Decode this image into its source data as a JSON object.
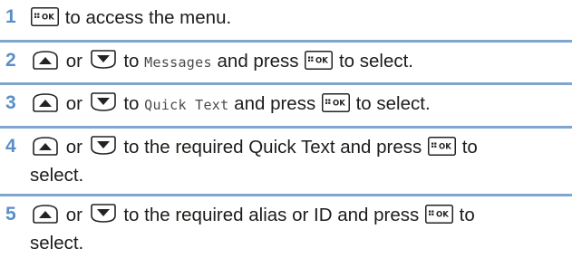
{
  "steps": [
    {
      "number": "1",
      "parts": [
        "to access the menu."
      ]
    },
    {
      "number": "2",
      "parts": [
        "or",
        "to",
        "Messages",
        "and press",
        "to select."
      ]
    },
    {
      "number": "3",
      "parts": [
        "or",
        "to",
        "Quick Text",
        "and press",
        "to select."
      ]
    },
    {
      "number": "4",
      "parts": [
        "or",
        "to the required Quick Text and press",
        "to",
        "select."
      ]
    },
    {
      "number": "5",
      "parts": [
        "or",
        "to the required alias or ID and press",
        "to",
        "select."
      ]
    }
  ],
  "keys": {
    "ok_key_label": "OK",
    "ok_key_icon": "menu-ok-key-icon",
    "up_key_icon": "up-arrow-key-icon",
    "down_key_icon": "down-arrow-key-icon"
  },
  "colors": {
    "step_number": "#5a8fc6",
    "separator": "#7fa6cf",
    "text": "#1d1d1b"
  }
}
